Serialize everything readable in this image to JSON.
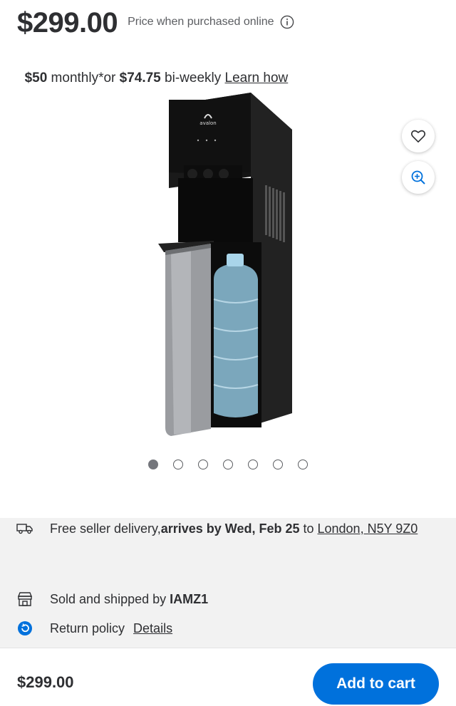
{
  "price": {
    "amount": "$299.00",
    "note": "Price when purchased online"
  },
  "financing": {
    "monthly_amount": "$50",
    "monthly_label": " monthly*or ",
    "biweekly_amount": "$74.75",
    "biweekly_label": " bi-weekly ",
    "learn_link": "Learn how"
  },
  "product_image": {
    "brand_text": "avalon"
  },
  "carousel": {
    "total": 7,
    "active_index": 0
  },
  "delivery": {
    "prefix": "Free seller delivery, ",
    "arrives": "arrives by Wed, Feb 25",
    "to": " to ",
    "location_link": "London, N5Y 9Z0"
  },
  "seller": {
    "prefix": "Sold and shipped by ",
    "name": "IAMZ1"
  },
  "returns": {
    "label": "Return policy",
    "link": "Details"
  },
  "bottom_bar": {
    "price": "$299.00",
    "cart_label": "Add to cart"
  },
  "colors": {
    "accent": "#0071dc",
    "text": "#2e2f32"
  }
}
